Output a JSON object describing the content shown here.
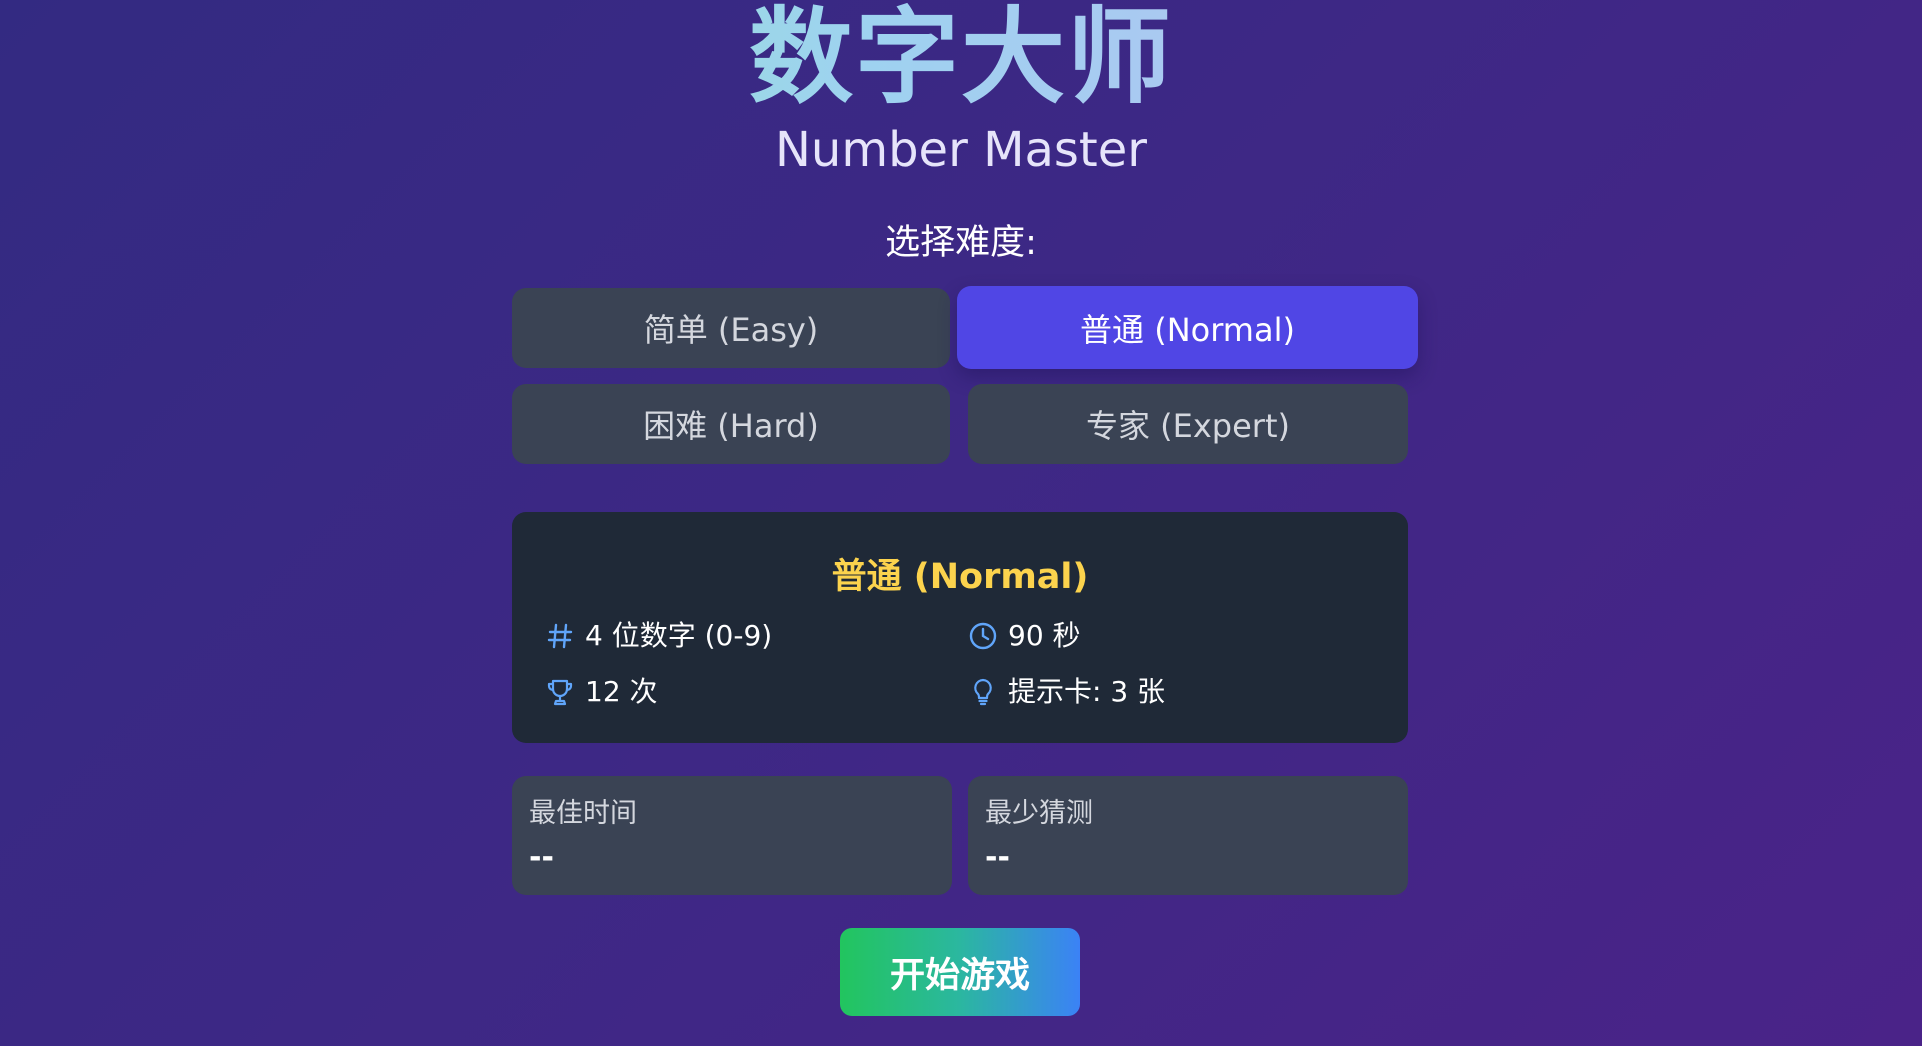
{
  "header": {
    "title_cn": "数字大师",
    "title_en": "Number Master"
  },
  "difficulty": {
    "label": "选择难度:",
    "options": [
      {
        "label": "简单 (Easy)",
        "selected": false
      },
      {
        "label": "普通 (Normal)",
        "selected": true
      },
      {
        "label": "困难 (Hard)",
        "selected": false
      },
      {
        "label": "专家 (Expert)",
        "selected": false
      }
    ]
  },
  "info": {
    "title": "普通 (Normal)",
    "digits": "4 位数字 (0-9)",
    "time": "90 秒",
    "attempts": "12 次",
    "hints": "提示卡: 3 张"
  },
  "stats": {
    "best_time_label": "最佳时间",
    "best_time_value": "--",
    "least_guesses_label": "最少猜测",
    "least_guesses_value": "--"
  },
  "actions": {
    "start_label": "开始游戏"
  },
  "icons": {
    "digits": "hash-icon",
    "time": "clock-icon",
    "attempts": "trophy-icon",
    "hints": "lightbulb-icon"
  },
  "colors": {
    "accent": "#5046e5",
    "info_title": "#fcd34d",
    "icon": "#60a5fa",
    "card_bg": "#1f2937",
    "button_bg": "#3a4354"
  }
}
